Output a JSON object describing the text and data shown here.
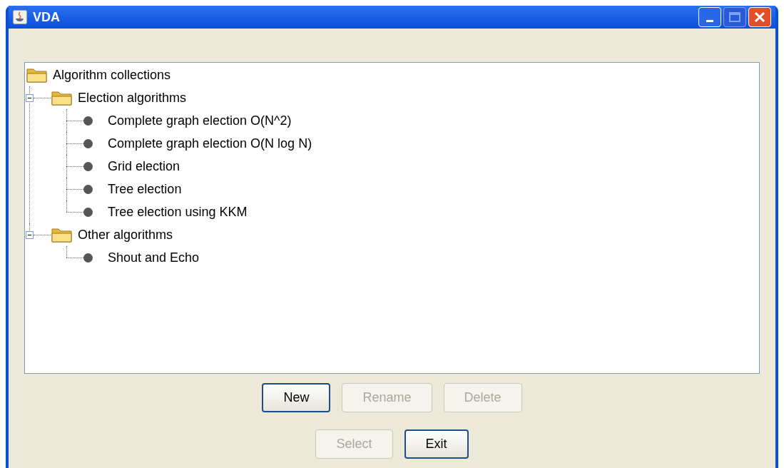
{
  "window": {
    "title": "VDA"
  },
  "tree": {
    "label": "Algorithm collections",
    "kind": "folder",
    "children": [
      {
        "label": "Election algorithms",
        "kind": "folder",
        "expanded": true,
        "children": [
          {
            "label": "Complete graph election O(N^2)",
            "kind": "leaf"
          },
          {
            "label": "Complete graph election O(N log N)",
            "kind": "leaf"
          },
          {
            "label": "Grid election",
            "kind": "leaf"
          },
          {
            "label": "Tree election",
            "kind": "leaf"
          },
          {
            "label": "Tree election using KKM",
            "kind": "leaf"
          }
        ]
      },
      {
        "label": "Other algorithms",
        "kind": "folder",
        "expanded": true,
        "children": [
          {
            "label": "Shout and Echo",
            "kind": "leaf"
          }
        ]
      }
    ]
  },
  "button_rows": [
    [
      {
        "label": "New",
        "disabled": false
      },
      {
        "label": "Rename",
        "disabled": true
      },
      {
        "label": "Delete",
        "disabled": true
      }
    ],
    [
      {
        "label": "Select",
        "disabled": true
      },
      {
        "label": "Exit",
        "disabled": false
      }
    ]
  ]
}
